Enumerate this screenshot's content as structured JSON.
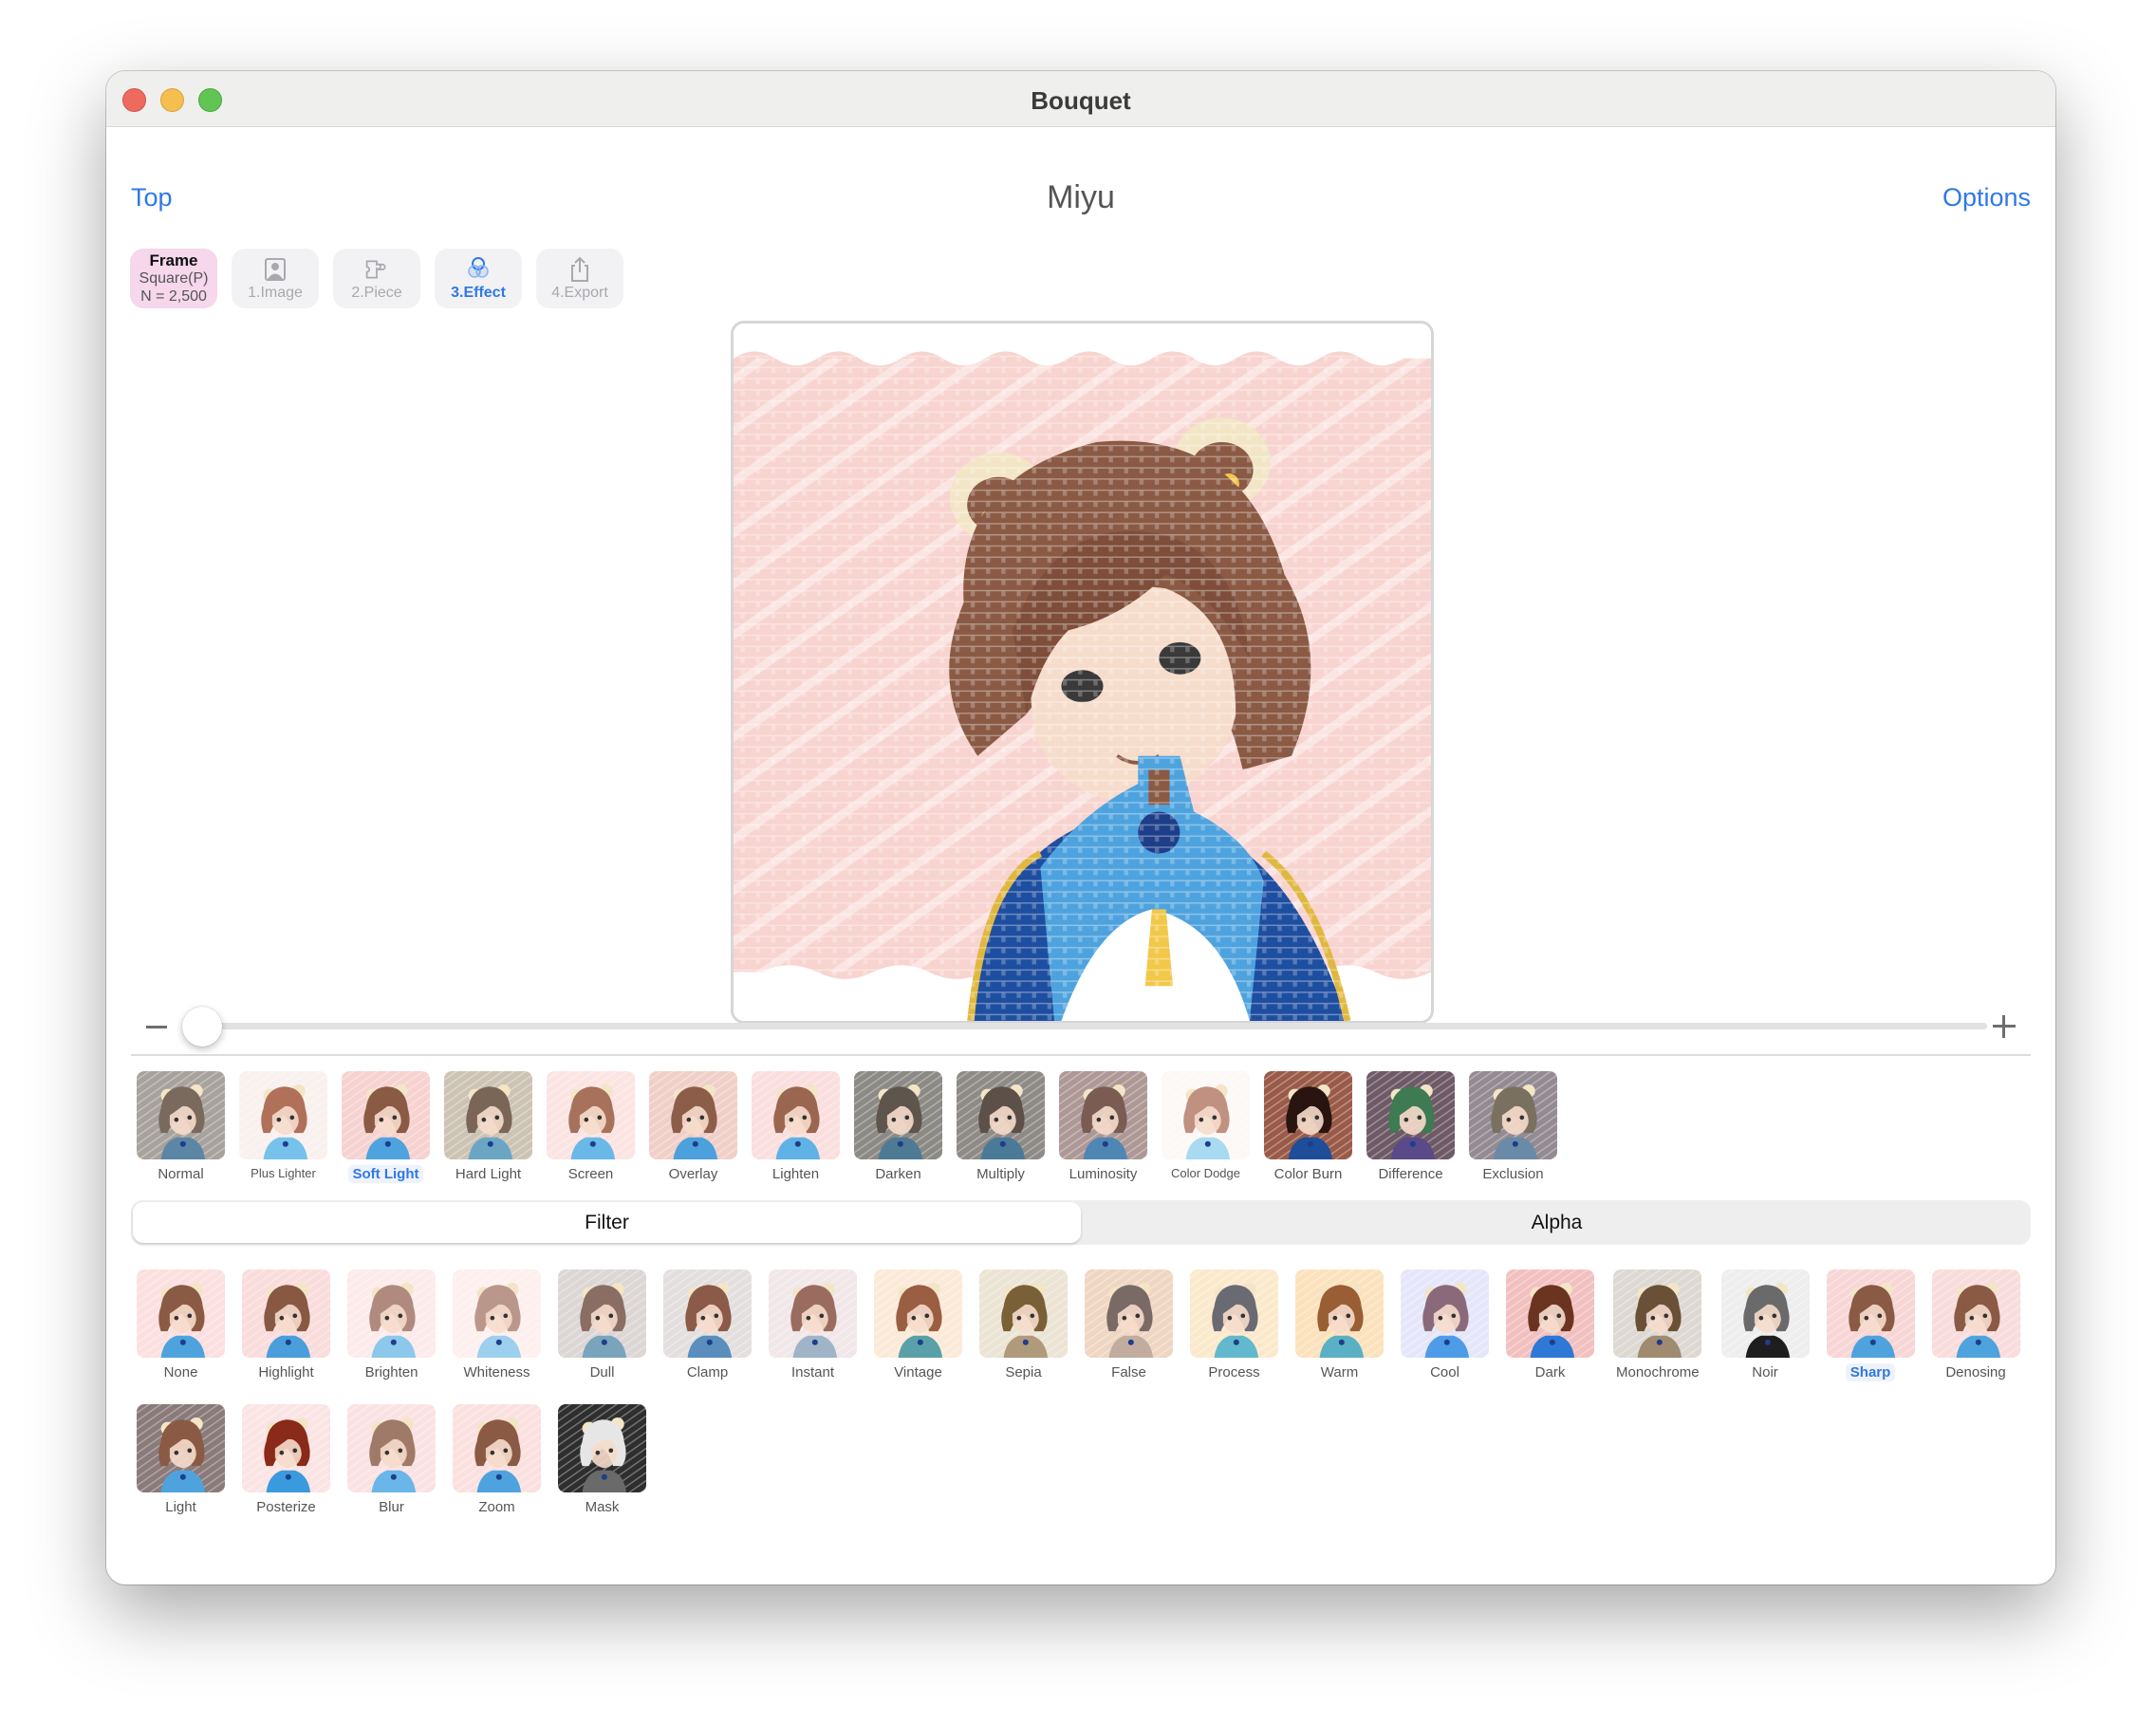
{
  "window": {
    "title": "Bouquet",
    "traffic_lights": [
      "close",
      "minimize",
      "zoom"
    ]
  },
  "nav": {
    "back_label": "Top",
    "document_title": "Miyu",
    "options_label": "Options"
  },
  "frame_info": {
    "title": "Frame",
    "shape": "Square(P)",
    "count": "N = 2,500"
  },
  "steps": [
    {
      "label": "1.Image",
      "icon": "photo-portrait-icon",
      "active": false
    },
    {
      "label": "2.Piece",
      "icon": "puzzle-piece-icon",
      "active": false
    },
    {
      "label": "3.Effect",
      "icon": "overlapping-circles-icon",
      "active": true
    },
    {
      "label": "4.Export",
      "icon": "share-icon",
      "active": false
    }
  ],
  "slider": {
    "minus_icon": "minus-icon",
    "plus_icon": "plus-icon",
    "value_fraction": 0.0
  },
  "blend_modes": {
    "selected": "Soft Light",
    "items": [
      {
        "label": "Normal",
        "bg": "#a8a29c",
        "hair": "#7a6a5e",
        "body": "#5c86a6"
      },
      {
        "label": "Plus Lighter",
        "bg": "#f8f1ee",
        "hair": "#b0705a",
        "body": "#76c2ea"
      },
      {
        "label": "Soft Light",
        "bg": "#f6d2d0",
        "hair": "#8a5a44",
        "body": "#4ea3de"
      },
      {
        "label": "Hard Light",
        "bg": "#cdc3b4",
        "hair": "#7a6656",
        "body": "#6aa6c4"
      },
      {
        "label": "Screen",
        "bg": "#fbe4e2",
        "hair": "#a8715c",
        "body": "#6ab8e8"
      },
      {
        "label": "Overlay",
        "bg": "#f0cfc8",
        "hair": "#8c5e4a",
        "body": "#4ca0dc"
      },
      {
        "label": "Lighten",
        "bg": "#fbdede",
        "hair": "#9a6650",
        "body": "#5eb2e6"
      },
      {
        "label": "Darken",
        "bg": "#8c8a84",
        "hair": "#5e554c",
        "body": "#4e7a94"
      },
      {
        "label": "Multiply",
        "bg": "#8e8a86",
        "hair": "#5c5048",
        "body": "#4a7a98"
      },
      {
        "label": "Luminosity",
        "bg": "#ad9896",
        "hair": "#7a5c52",
        "body": "#4f86b4"
      },
      {
        "label": "Color Dodge",
        "bg": "#fcf8f6",
        "hair": "#c09080",
        "body": "#a8daf2"
      },
      {
        "label": "Color Burn",
        "bg": "#9a5a48",
        "hair": "#2a1410",
        "body": "#1e4e9a"
      },
      {
        "label": "Difference",
        "bg": "#6e5a66",
        "hair": "#3e7a52",
        "body": "#5a4a8a"
      },
      {
        "label": "Exclusion",
        "bg": "#948a92",
        "hair": "#7a7060",
        "body": "#6a8aa8"
      }
    ]
  },
  "tabs": {
    "selected": "Filter",
    "items": [
      "Filter",
      "Alpha"
    ]
  },
  "filters": {
    "selected": "Sharp",
    "row1": [
      {
        "label": "None",
        "bg": "#fbe0df",
        "hair": "#8a5a44",
        "body": "#4ea3de"
      },
      {
        "label": "Highlight",
        "bg": "#fadcdc",
        "hair": "#885842",
        "body": "#4a9edc"
      },
      {
        "label": "Brighten",
        "bg": "#fcebea",
        "hair": "#b08a7e",
        "body": "#8cc8ec"
      },
      {
        "label": "Whiteness",
        "bg": "#fdf0ef",
        "hair": "#bb968a",
        "body": "#9cd0ee"
      },
      {
        "label": "Dull",
        "bg": "#dcd6d5",
        "hair": "#8a6e64",
        "body": "#7aa4bc"
      },
      {
        "label": "Clamp",
        "bg": "#e3dfdf",
        "hair": "#8c5a48",
        "body": "#5a8ebc"
      },
      {
        "label": "Instant",
        "bg": "#f1e6e8",
        "hair": "#9a6c60",
        "body": "#a0b4c8"
      },
      {
        "label": "Vintage",
        "bg": "#fbead8",
        "hair": "#9a5e42",
        "body": "#5aa0a8"
      },
      {
        "label": "Sepia",
        "bg": "#ece4d4",
        "hair": "#7a6036",
        "body": "#b09a7c"
      },
      {
        "label": "False",
        "bg": "#efd6c2",
        "hair": "#7a6a66",
        "body": "#c2aca0"
      },
      {
        "label": "Process",
        "bg": "#fbe9cc",
        "hair": "#6a6a72",
        "body": "#62b8cc"
      },
      {
        "label": "Warm",
        "bg": "#fbe2bc",
        "hair": "#9a5e34",
        "body": "#5ab0c4"
      },
      {
        "label": "Cool",
        "bg": "#e6e6fa",
        "hair": "#8a6a7a",
        "body": "#4e9ce8"
      },
      {
        "label": "Dark",
        "bg": "#f3c0c0",
        "hair": "#6a3420",
        "body": "#2e78d6"
      },
      {
        "label": "Monochrome",
        "bg": "#ddd8d2",
        "hair": "#6a5036",
        "body": "#a08a70"
      },
      {
        "label": "Noir",
        "bg": "#eeeeee",
        "hair": "#6a6a6a",
        "body": "#1e1e1e"
      },
      {
        "label": "Sharp",
        "bg": "#f8d6d6",
        "hair": "#8a5a44",
        "body": "#4ea3de"
      },
      {
        "label": "Denosing",
        "bg": "#f9dcdc",
        "hair": "#8a5a44",
        "body": "#4ea3de"
      }
    ],
    "row2": [
      {
        "label": "Light",
        "bg": "#8a7a7a",
        "hair": "#8a5a44",
        "body": "#4ea3de"
      },
      {
        "label": "Posterize",
        "bg": "#fbe4e4",
        "hair": "#8a2a1a",
        "body": "#3a9ade"
      },
      {
        "label": "Blur",
        "bg": "#fbe2e2",
        "hair": "#a07a68",
        "body": "#6ab6e8"
      },
      {
        "label": "Zoom",
        "bg": "#fbe0e0",
        "hair": "#8a5a44",
        "body": "#4ea3de"
      },
      {
        "label": "Mask",
        "bg": "#2e2e2e",
        "hair": "#e6e6e6",
        "body": "#6a6a6a"
      }
    ]
  },
  "preview": {
    "subject": "mosaic portrait of anime girl with bear ears",
    "bg_color": "#f8d4d0",
    "hair_color": "#8a5a44",
    "jacket_color": "#4ea3de",
    "jacket_dark_color": "#1e4ea0"
  },
  "colors": {
    "accent": "#2f78e8",
    "frame_badge": "#f6d7ec",
    "segment_bg": "#eeeeee"
  }
}
